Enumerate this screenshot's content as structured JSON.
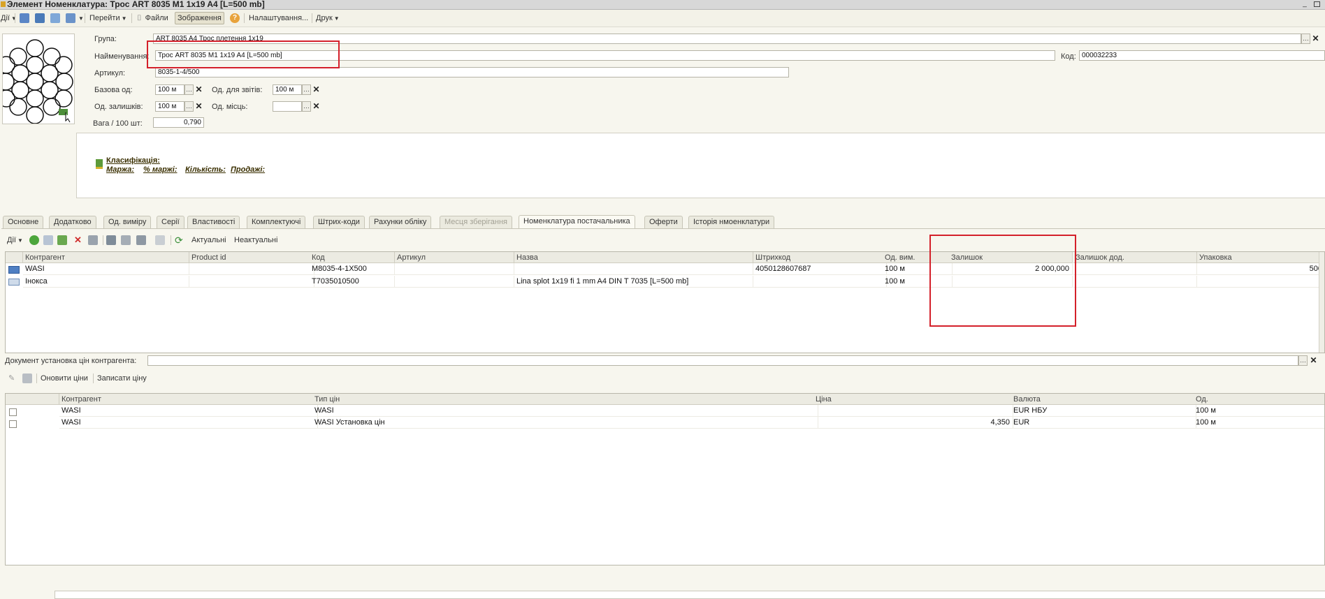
{
  "window": {
    "title": "Элемент Номенклатура: Трос ART 8035 M1 1x19 A4 [L=500 mb]"
  },
  "toolbar": {
    "actions_label": "Дії",
    "goto_label": "Перейти",
    "files_label": "Файли",
    "images_label": "Зображення",
    "settings_label": "Налаштування...",
    "print_label": "Друк"
  },
  "form": {
    "group_label": "Група:",
    "group_value": "ART 8035 A4 Трос плетення 1x19",
    "name_label": "Найменування:",
    "name_value": "Трос ART 8035 M1 1x19 A4 [L=500 mb]",
    "code_label": "Код:",
    "code_value": "000032233",
    "article_label": "Артикул:",
    "article_value": "8035-1-4/500",
    "base_unit_label": "Базова од:",
    "base_unit_value": "100 м",
    "report_unit_label": "Од. для звітів:",
    "report_unit_value": "100 м",
    "stock_unit_label": "Од. залишків:",
    "stock_unit_value": "100 м",
    "place_unit_label": "Од. місць:",
    "place_unit_value": "",
    "weight_label": "Вага / 100 шт:",
    "weight_value": "0,790"
  },
  "info": {
    "classification": "Класифікація:",
    "margin": "Маржа:",
    "margin_pct": "% маржі:",
    "quantity": "Кількість:",
    "sales": "Продажі:"
  },
  "tabs": [
    {
      "label": "Основне",
      "state": "normal"
    },
    {
      "label": "Додатково",
      "state": "normal"
    },
    {
      "label": "Од. виміру",
      "state": "normal"
    },
    {
      "label": "Серії",
      "state": "normal"
    },
    {
      "label": "Властивості",
      "state": "normal"
    },
    {
      "label": "Комплектуючі",
      "state": "normal"
    },
    {
      "label": "Штрих-коди",
      "state": "normal"
    },
    {
      "label": "Рахунки обліку",
      "state": "normal"
    },
    {
      "label": "Месця зберігання",
      "state": "disabled"
    },
    {
      "label": "Номенклатура постачальника",
      "state": "active"
    },
    {
      "label": "Оферти",
      "state": "normal"
    },
    {
      "label": "Історія нмоенклатури",
      "state": "normal"
    }
  ],
  "supplier_toolbar": {
    "actions_label": "Дії",
    "actual_label": "Актуальні",
    "inactual_label": "Неактуальні"
  },
  "supplier_table": {
    "columns": [
      "Контрагент",
      "Product id",
      "Код",
      "Артикул",
      "Назва",
      "Штрихкод",
      "Од. вим.",
      "Залишок",
      "Залишок дод.",
      "Упаковка"
    ],
    "rows": [
      [
        "WASI",
        "",
        "M8035-4-1X500",
        "",
        "",
        "4050128607687",
        "100 м",
        "2 000,000",
        "",
        "500"
      ],
      [
        "Інокса",
        "",
        "T7035010500",
        "",
        "Lina splot 1x19 fi 1 mm A4 DIN T 7035 [L=500 mb]",
        "",
        "100 м",
        "",
        "",
        ""
      ]
    ]
  },
  "price_doc": {
    "label": "Документ установка цін контрагента:",
    "value": ""
  },
  "price_toolbar": {
    "refresh_label": "Оновити ціни",
    "write_label": "Записати ціну"
  },
  "price_table": {
    "columns": [
      "",
      "Контрагент",
      "Тип цін",
      "Ціна",
      "Валюта",
      "Од."
    ],
    "rows": [
      [
        "",
        "WASI",
        "WASI",
        "",
        "EUR НБУ",
        "100 м"
      ],
      [
        "",
        "WASI",
        "WASI Установка цін",
        "4,350",
        "EUR",
        "100 м"
      ]
    ]
  },
  "colors": {
    "highlight": "#d4202a",
    "background": "#f7f6ee"
  }
}
